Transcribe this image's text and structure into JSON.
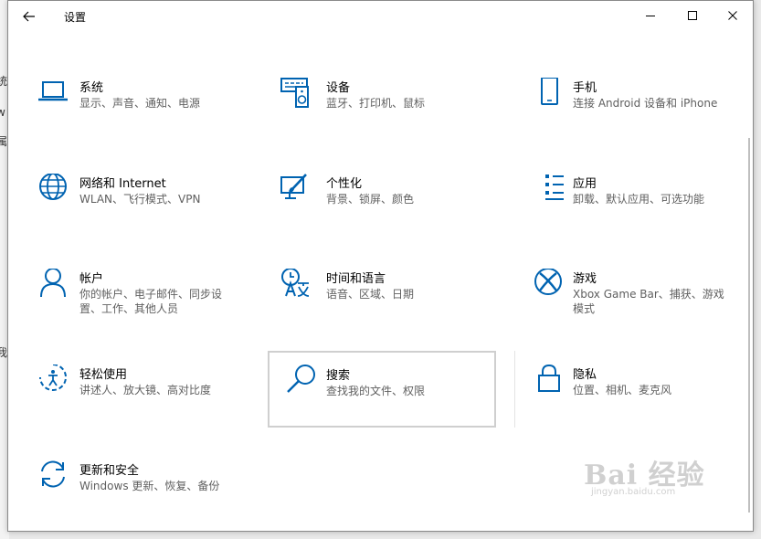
{
  "window": {
    "title": "设置",
    "back_icon": "arrow-left-icon",
    "minimize_icon": "minimize-icon",
    "maximize_icon": "maximize-icon",
    "close_icon": "close-icon"
  },
  "background_fragments": [
    "统",
    "w",
    "属",
    "我"
  ],
  "tiles": [
    {
      "name": "系统",
      "desc": "显示、声音、通知、电源",
      "icon": "laptop-icon"
    },
    {
      "name": "设备",
      "desc": "蓝牙、打印机、鼠标",
      "icon": "keyboard-speaker-icon"
    },
    {
      "name": "手机",
      "desc": "连接 Android 设备和 iPhone",
      "icon": "phone-icon"
    },
    {
      "name": "网络和 Internet",
      "desc": "WLAN、飞行模式、VPN",
      "icon": "globe-icon"
    },
    {
      "name": "个性化",
      "desc": "背景、锁屏、颜色",
      "icon": "paint-monitor-icon"
    },
    {
      "name": "应用",
      "desc": "卸载、默认应用、可选功能",
      "icon": "app-list-icon"
    },
    {
      "name": "帐户",
      "desc": "你的帐户、电子邮件、同步设置、工作、其他人员",
      "icon": "person-icon"
    },
    {
      "name": "时间和语言",
      "desc": "语音、区域、日期",
      "icon": "time-language-icon"
    },
    {
      "name": "游戏",
      "desc": "Xbox Game Bar、捕获、游戏模式",
      "icon": "xbox-icon"
    },
    {
      "name": "轻松使用",
      "desc": "讲述人、放大镜、高对比度",
      "icon": "ease-of-access-icon"
    },
    {
      "name": "搜索",
      "desc": "查找我的文件、权限",
      "icon": "search-icon"
    },
    {
      "name": "隐私",
      "desc": "位置、相机、麦克风",
      "icon": "lock-icon"
    },
    {
      "name": "更新和安全",
      "desc": "Windows 更新、恢复、备份",
      "icon": "sync-icon"
    }
  ],
  "watermark": {
    "line1": "Bai 经验",
    "line2": "jingyan.baidu.com"
  },
  "colors": {
    "accent": "#0063b1"
  }
}
